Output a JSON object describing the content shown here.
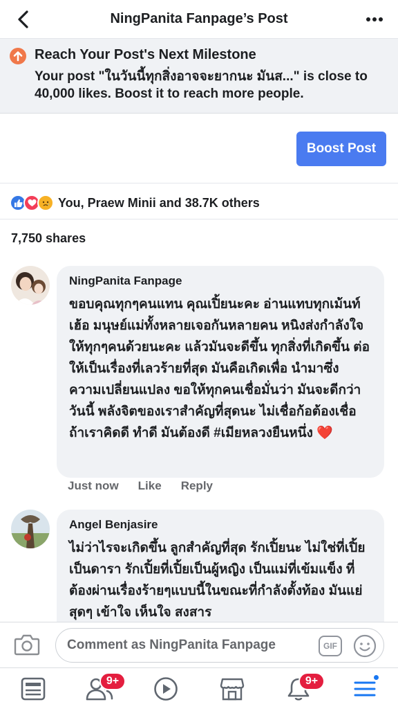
{
  "header": {
    "title": "NingPanita Fanpage’s Post"
  },
  "milestone": {
    "title": "Reach Your Post's Next Milestone",
    "body": "Your post \"ในวันนี้ทุกสิ่งอาจจะยากนะ มันส...\" is close to 40,000 likes. Boost it to reach more people."
  },
  "boost": {
    "label": "Boost Post"
  },
  "reactions": {
    "summary": "You, Praew Minii and 38.7K others"
  },
  "shares": {
    "label": "7,750 shares"
  },
  "comments": [
    {
      "author": "NingPanita Fanpage",
      "text": "ขอบคุณทุกๆคนแทน คุณเปิ้ยนะคะ อ่านแทบทุกเม้นท์ เฮ้อ มนุษย์แม่ทั้งหลายเจอกันหลายคน หนิงส่งกำลังใจให้ทุกๆคนด้วยนะคะ แล้วมันจะดีขึ้น ทุกสิ่งที่เกิดขึ้น ต่อให้เป็นเรื่องที่เลวร้ายที่สุด มันคือเกิดเพื่อ นำมาซึ่ง ความเปลี่ยนแปลง ขอให้ทุกคนเชื่อมั่นว่า มันจะดีกว่าวันนี้ พลังจิตของเราสำคัญที่สุดนะ ไม่เชื่อก้อต้องเชื่อ ถ้าเราคิดดี ทำดี มันต้องดี #เมียหลวงยืนหนึ่ง ❤️",
      "time": "Just now",
      "like": "Like",
      "reply": "Reply"
    },
    {
      "author": "Angel Benjasire",
      "text": "ไม่ว่าไรจะเกิดขึ้น  ลูกสำคัญที่สุด  รักเปิ้ยนะ  ไม่ใช่ที่เปิ้ยเป็นดารา  รักเปิ้ยที่เปิ้ยเป็นผู้หญิง  เป็นแม่ที่เข้มแข็ง  ที่ต้องผ่านเรื่องร้ายๆแบบนี้ในขณะที่กำลังตั้งท้อง  มันแย่สุดๆ  เข้าใจ  เห็นใจ  สงสาร"
    }
  ],
  "composer": {
    "placeholder": "Comment as NingPanita Fanpage",
    "gif": "GIF"
  },
  "nav": {
    "friends_badge": "9+",
    "notifications_badge": "9+"
  },
  "colors": {
    "accent": "#4a7bf0",
    "badge": "#e41e3f",
    "milestone_icon": "#f0784a"
  }
}
